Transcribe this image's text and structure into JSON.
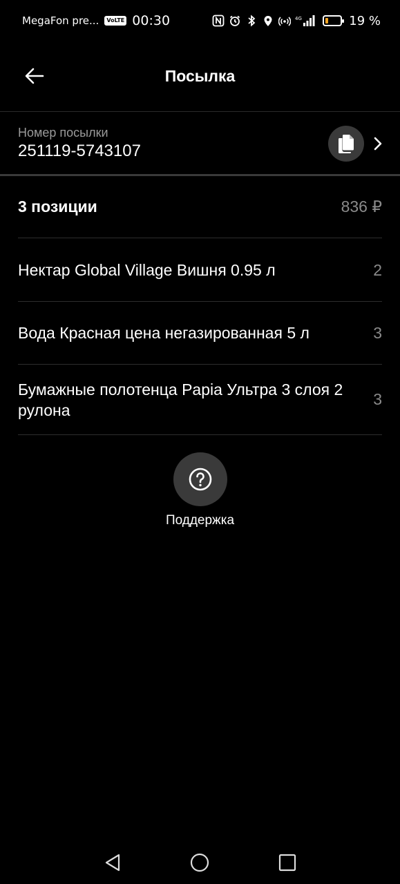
{
  "status_bar": {
    "carrier": "MegaFon pre...",
    "volte": "VoLTE",
    "time": "00:30",
    "network": "4G",
    "battery_percent": "19 %",
    "battery_level": 0.19
  },
  "header": {
    "title": "Посылка"
  },
  "parcel": {
    "label": "Номер посылки",
    "number": "251119-5743107"
  },
  "summary": {
    "count_label": "3 позиции",
    "total": "836 ₽"
  },
  "items": [
    {
      "name": "Нектар Global Village Вишня 0.95 л",
      "qty": "2"
    },
    {
      "name": "Вода Красная цена негазированная 5 л",
      "qty": "3"
    },
    {
      "name": "Бумажные полотенца Papia Ультра 3 слоя 2 рулона",
      "qty": "3"
    }
  ],
  "support": {
    "label": "Поддержка"
  },
  "colors": {
    "background": "#000000",
    "muted_text": "#8a8a8a",
    "button_bg": "#3a3a3a",
    "battery_low": "#f5a623"
  }
}
